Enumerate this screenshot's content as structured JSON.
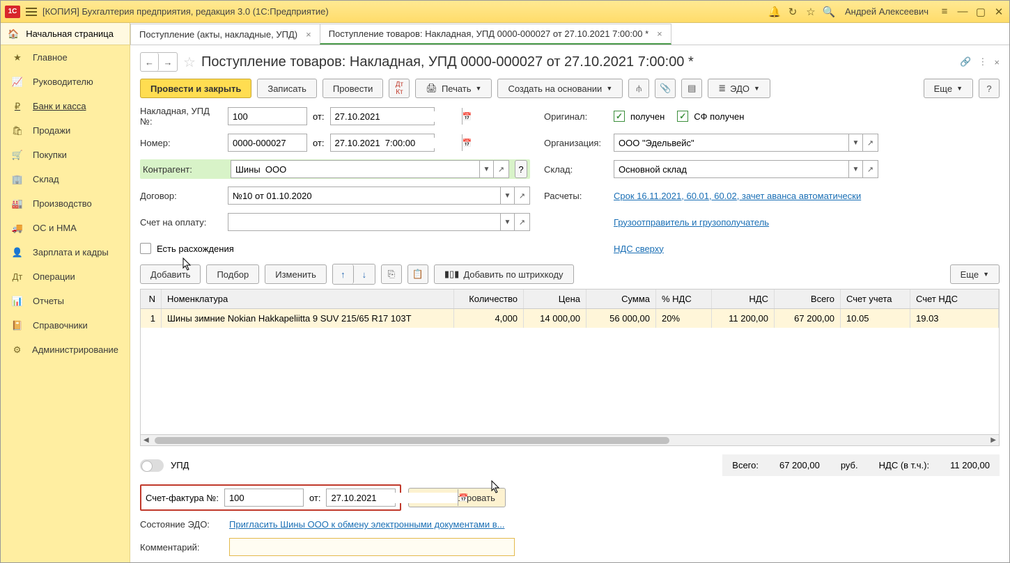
{
  "app": {
    "title": "[КОПИЯ] Бухгалтерия предприятия, редакция 3.0  (1С:Предприятие)",
    "user": "Андрей Алексеевич"
  },
  "home_label": "Начальная страница",
  "sidebar": [
    {
      "icon": "★",
      "label": "Главное"
    },
    {
      "icon": "📈",
      "label": "Руководителю"
    },
    {
      "icon": "₽",
      "label": "Банк и касса"
    },
    {
      "icon": "🛍",
      "label": "Продажи"
    },
    {
      "icon": "🛒",
      "label": "Покупки"
    },
    {
      "icon": "🏢",
      "label": "Склад"
    },
    {
      "icon": "🏭",
      "label": "Производство"
    },
    {
      "icon": "🚚",
      "label": "ОС и НМА"
    },
    {
      "icon": "👤",
      "label": "Зарплата и кадры"
    },
    {
      "icon": "Дт",
      "label": "Операции"
    },
    {
      "icon": "📊",
      "label": "Отчеты"
    },
    {
      "icon": "📔",
      "label": "Справочники"
    },
    {
      "icon": "⚙",
      "label": "Администрирование"
    }
  ],
  "tabs": [
    {
      "label": "Поступление (акты, накладные, УПД)"
    },
    {
      "label": "Поступление товаров: Накладная, УПД 0000-000027 от 27.10.2021 7:00:00 *"
    }
  ],
  "doc": {
    "title": "Поступление товаров: Накладная, УПД 0000-000027 от 27.10.2021 7:00:00 *"
  },
  "toolbar": {
    "post_close": "Провести и закрыть",
    "write": "Записать",
    "post": "Провести",
    "print": "Печать",
    "create_based": "Создать на основании",
    "edo": "ЭДО",
    "more": "Еще"
  },
  "fields": {
    "invoice_lbl": "Накладная, УПД №:",
    "invoice_no": "100",
    "from": "от:",
    "invoice_date": "27.10.2021",
    "number_lbl": "Номер:",
    "number": "0000-000027",
    "number_date": "27.10.2021  7:00:00",
    "kontr_lbl": "Контрагент:",
    "kontr": "Шины  ООО",
    "dog_lbl": "Договор:",
    "dog": "№10 от 01.10.2020",
    "schet_lbl": "Счет на оплату:",
    "schet": "",
    "rash_lbl": "Есть расхождения",
    "orig_lbl": "Оригинал:",
    "orig_recv": "получен",
    "sf_recv": "СФ получен",
    "org_lbl": "Организация:",
    "org": "ООО \"Эдельвейс\"",
    "sklad_lbl": "Склад:",
    "sklad": "Основной склад",
    "rasch_lbl": "Расчеты:",
    "rasch_link": "Срок 16.11.2021, 60.01, 60.02, зачет аванса автоматически",
    "gruz_link": "Грузоотправитель и грузополучатель",
    "nds_link": "НДС сверху"
  },
  "tbl_toolbar": {
    "add": "Добавить",
    "pick": "Подбор",
    "change": "Изменить",
    "barcode": "Добавить по штрихкоду",
    "more": "Еще"
  },
  "columns": {
    "n": "N",
    "nom": "Номенклатура",
    "qty": "Количество",
    "price": "Цена",
    "sum": "Сумма",
    "vatrate": "% НДС",
    "vat": "НДС",
    "total": "Всего",
    "acc": "Счет учета",
    "acc_nds": "Счет НДС"
  },
  "rows": [
    {
      "n": "1",
      "nom": "Шины зимние Nokian Hakkapeliitta 9 SUV 215/65 R17 103T",
      "qty": "4,000",
      "price": "14 000,00",
      "sum": "56 000,00",
      "vatrate": "20%",
      "vat": "11 200,00",
      "total": "67 200,00",
      "acc": "10.05",
      "acc_nds": "19.03"
    }
  ],
  "footer": {
    "upd": "УПД",
    "tot_lbl": "Всего:",
    "tot": "67 200,00",
    "cur": "руб.",
    "nds_lbl": "НДС (в т.ч.):",
    "nds": "11 200,00",
    "sf_lbl": "Счет-фактура №:",
    "sf_no": "100",
    "sf_date": "27.10.2021",
    "reg": "Зарегистрировать",
    "edo_lbl": "Состояние ЭДО:",
    "edo_link": "Пригласить Шины  ООО к обмену электронными документами в...",
    "comm_lbl": "Комментарий:",
    "comm": ""
  }
}
